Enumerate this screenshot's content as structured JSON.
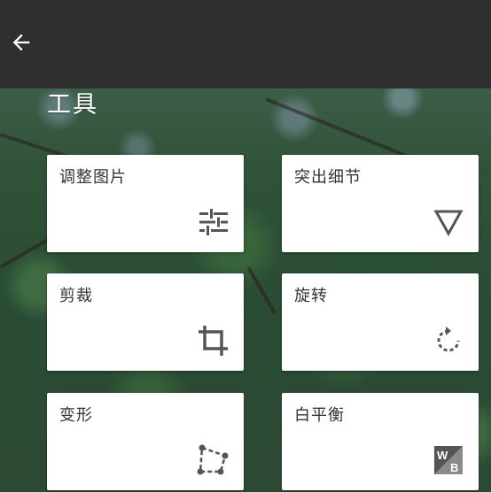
{
  "appbar": {
    "back_icon": "arrow-back-icon"
  },
  "section": {
    "title": "工具"
  },
  "tools": [
    {
      "label": "调整图片",
      "icon": "tune-sliders-icon"
    },
    {
      "label": "突出细节",
      "icon": "triangle-down-icon"
    },
    {
      "label": "剪裁",
      "icon": "crop-icon"
    },
    {
      "label": "旋转",
      "icon": "rotate-icon"
    },
    {
      "label": "变形",
      "icon": "perspective-icon"
    },
    {
      "label": "白平衡",
      "icon": "white-balance-icon"
    }
  ],
  "colors": {
    "appbar": "#2f2f2f",
    "card": "#ffffff",
    "text": "#333333",
    "icon": "#555555"
  }
}
